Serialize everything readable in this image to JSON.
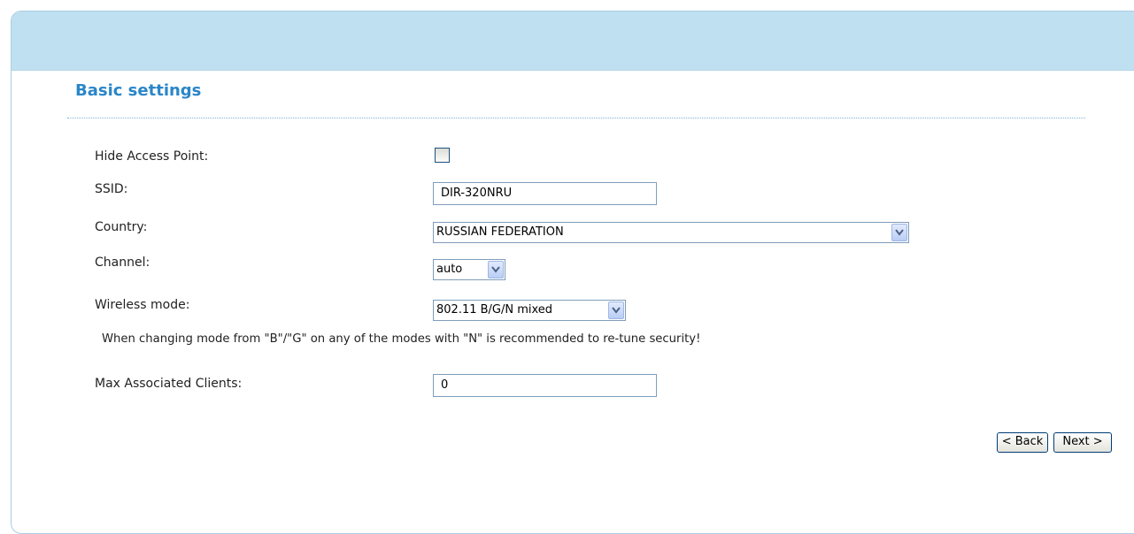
{
  "section": {
    "title": "Basic settings"
  },
  "fields": {
    "hide_access_point": {
      "label": "Hide Access Point:",
      "checked": false
    },
    "ssid": {
      "label": "SSID:",
      "value": "DIR-320NRU"
    },
    "country": {
      "label": "Country:",
      "value": "RUSSIAN FEDERATION"
    },
    "channel": {
      "label": "Channel:",
      "value": "auto"
    },
    "wireless_mode": {
      "label": "Wireless mode:",
      "value": "802.11 B/G/N mixed"
    },
    "max_clients": {
      "label": "Max Associated Clients:",
      "value": "0"
    }
  },
  "note": "When changing mode from \"B\"/\"G\" on any of the modes with \"N\" is recommended to re-tune security!",
  "buttons": {
    "back": "< Back",
    "next": "Next >"
  },
  "icons": {
    "dropdown": "chevron-down-icon"
  },
  "colors": {
    "header_bg": "#bfe0f0",
    "title": "#2a86c8",
    "border": "#a9cfe3"
  }
}
